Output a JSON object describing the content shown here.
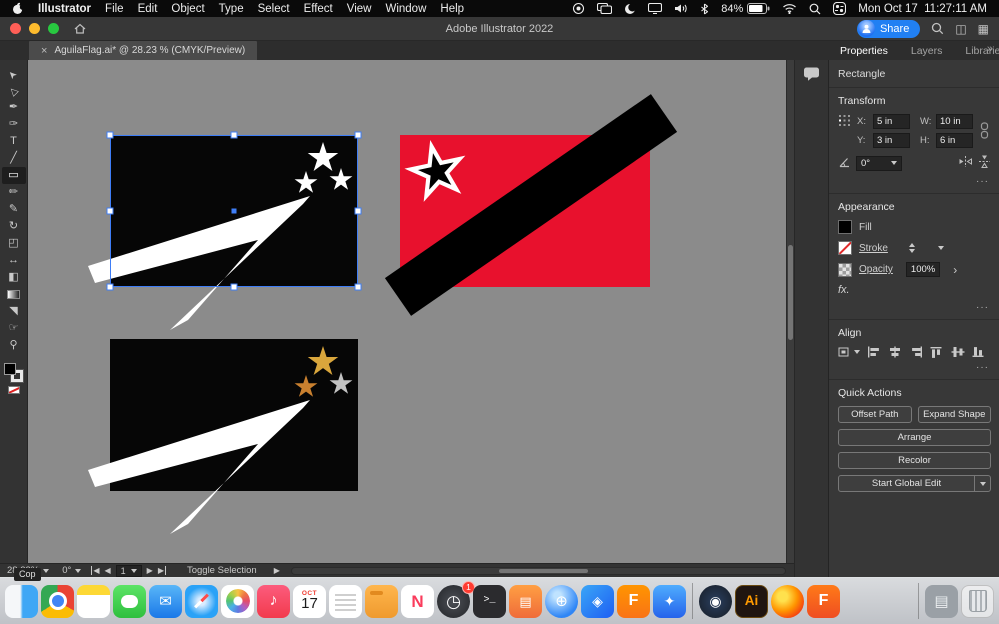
{
  "menubar": {
    "app_name": "Illustrator",
    "menus": [
      "File",
      "Edit",
      "Object",
      "Type",
      "Select",
      "Effect",
      "View",
      "Window",
      "Help"
    ],
    "battery_percent": "84%",
    "clock": "Mon Oct 17  11:27:11 AM"
  },
  "titlebar": {
    "title": "Adobe Illustrator 2022",
    "share_label": "Share"
  },
  "tabbar": {
    "tab_label": "AguilaFlag.ai* @ 28.23 % (CMYK/Preview)",
    "close_glyph": "×",
    "collapse_glyph": "»"
  },
  "tools": [
    {
      "name": "selection-tool",
      "glyph": "➤"
    },
    {
      "name": "direct-selection-tool",
      "glyph": "▷"
    },
    {
      "name": "pen-tool",
      "glyph": "✒"
    },
    {
      "name": "curvature-tool",
      "glyph": "✑"
    },
    {
      "name": "type-tool",
      "glyph": "T"
    },
    {
      "name": "line-segment-tool",
      "glyph": "╱"
    },
    {
      "name": "rectangle-tool",
      "glyph": "▭"
    },
    {
      "name": "paintbrush-tool",
      "glyph": "✏"
    },
    {
      "name": "pencil-tool",
      "glyph": "✎"
    },
    {
      "name": "rotate-tool",
      "glyph": "↻"
    },
    {
      "name": "scale-tool",
      "glyph": "◰"
    },
    {
      "name": "width-tool",
      "glyph": "↔"
    },
    {
      "name": "shape-builder-tool",
      "glyph": "◧"
    },
    {
      "name": "eyedropper-tool",
      "glyph": "◥"
    },
    {
      "name": "hand-tool",
      "glyph": "☞"
    },
    {
      "name": "zoom-tool",
      "glyph": "⚲"
    },
    {
      "name": "toolbar-more",
      "glyph": "⋯"
    }
  ],
  "panel": {
    "tabs": [
      {
        "label": "Properties"
      },
      {
        "label": "Layers"
      },
      {
        "label": "Libraries"
      }
    ],
    "object_type": "Rectangle",
    "more_glyph": "···",
    "transform": {
      "header": "Transform",
      "x_label": "X:",
      "x_value": "5 in",
      "y_label": "Y:",
      "y_value": "3 in",
      "w_label": "W:",
      "w_value": "10 in",
      "h_label": "H:",
      "h_value": "6 in",
      "angle_value": "0°"
    },
    "appearance": {
      "header": "Appearance",
      "fill_label": "Fill",
      "stroke_label": "Stroke",
      "opacity_label": "Opacity",
      "opacity_value": "100%",
      "fx_label": "fx.",
      "opacity_chevron": "›"
    },
    "align": {
      "header": "Align"
    },
    "quick_actions": {
      "header": "Quick Actions",
      "offset_path": "Offset Path",
      "expand_shape": "Expand Shape",
      "arrange": "Arrange",
      "recolor": "Recolor",
      "start_global_edit": "Start Global Edit"
    }
  },
  "statusbar": {
    "zoom": "28.23%",
    "rotation": "0°",
    "artboard_number": "1",
    "toggle_label": "Toggle Selection",
    "play_glyph": "▶"
  },
  "canvas": {
    "colors": {
      "pasteboard": "#8B8B8B",
      "flag_black": "#060606",
      "flag_red": "#E8112D",
      "band_black": "#000000",
      "star_white": "#FFFFFF",
      "star_gold": "#D9A63C",
      "star_orange": "#C9802F",
      "star_silver": "#C2C2C2",
      "selection_blue": "#3E7DF6"
    }
  },
  "overlay_chip": "Cop",
  "dock": {
    "items": [
      {
        "name": "finder"
      },
      {
        "name": "chrome"
      },
      {
        "name": "notes"
      },
      {
        "name": "messages"
      },
      {
        "name": "mail",
        "glyph": "✉"
      },
      {
        "name": "safari"
      },
      {
        "name": "photos"
      },
      {
        "name": "music",
        "glyph": "♪"
      },
      {
        "name": "calendar",
        "month": "OCT",
        "day": "17"
      },
      {
        "name": "reminders"
      },
      {
        "name": "folder"
      },
      {
        "name": "news",
        "glyph": "N"
      },
      {
        "name": "clock",
        "glyph": "◷",
        "badge": "1"
      },
      {
        "name": "terminal",
        "glyph": ">_"
      },
      {
        "name": "books",
        "glyph": "▤"
      },
      {
        "name": "globe",
        "glyph": "⊕"
      },
      {
        "name": "shortcuts",
        "glyph": "◈"
      },
      {
        "name": "app-f",
        "glyph": "F"
      },
      {
        "name": "app-blue",
        "glyph": "✦"
      },
      {
        "name": "steam",
        "glyph": "◉"
      },
      {
        "name": "illustrator",
        "glyph": "Ai"
      },
      {
        "name": "firefox"
      },
      {
        "name": "app-f-2",
        "glyph": "F"
      },
      {
        "name": "stacks",
        "glyph": "▤"
      },
      {
        "name": "trash"
      }
    ]
  }
}
